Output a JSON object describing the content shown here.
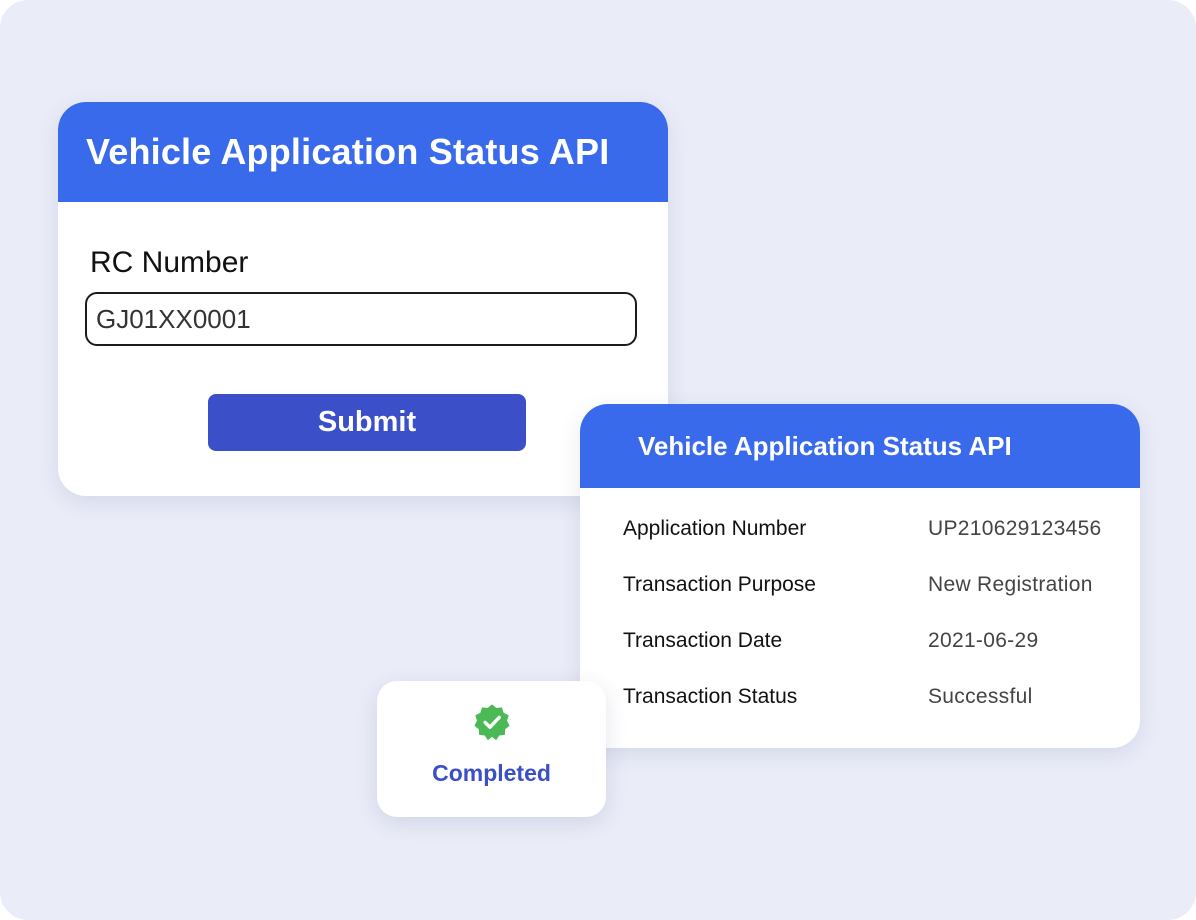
{
  "form_card": {
    "title": "Vehicle Application Status API",
    "rc_label": "RC Number",
    "rc_value": "GJ01XX0001",
    "submit_label": "Submit"
  },
  "result_card": {
    "title": "Vehicle Application Status API",
    "rows": [
      {
        "label": "Application Number",
        "value": "UP210629123456"
      },
      {
        "label": "Transaction Purpose",
        "value": "New Registration"
      },
      {
        "label": "Transaction Date",
        "value": "2021-06-29"
      },
      {
        "label": "Transaction Status",
        "value": "Successful"
      }
    ]
  },
  "status_badge": {
    "label": "Completed",
    "icon": "verified-check-icon",
    "icon_color": "#4cb957",
    "label_color": "#3a4fc8"
  },
  "colors": {
    "background": "#eaecf8",
    "header_blue": "#3a6aec",
    "button_blue": "#3a4fc8"
  }
}
